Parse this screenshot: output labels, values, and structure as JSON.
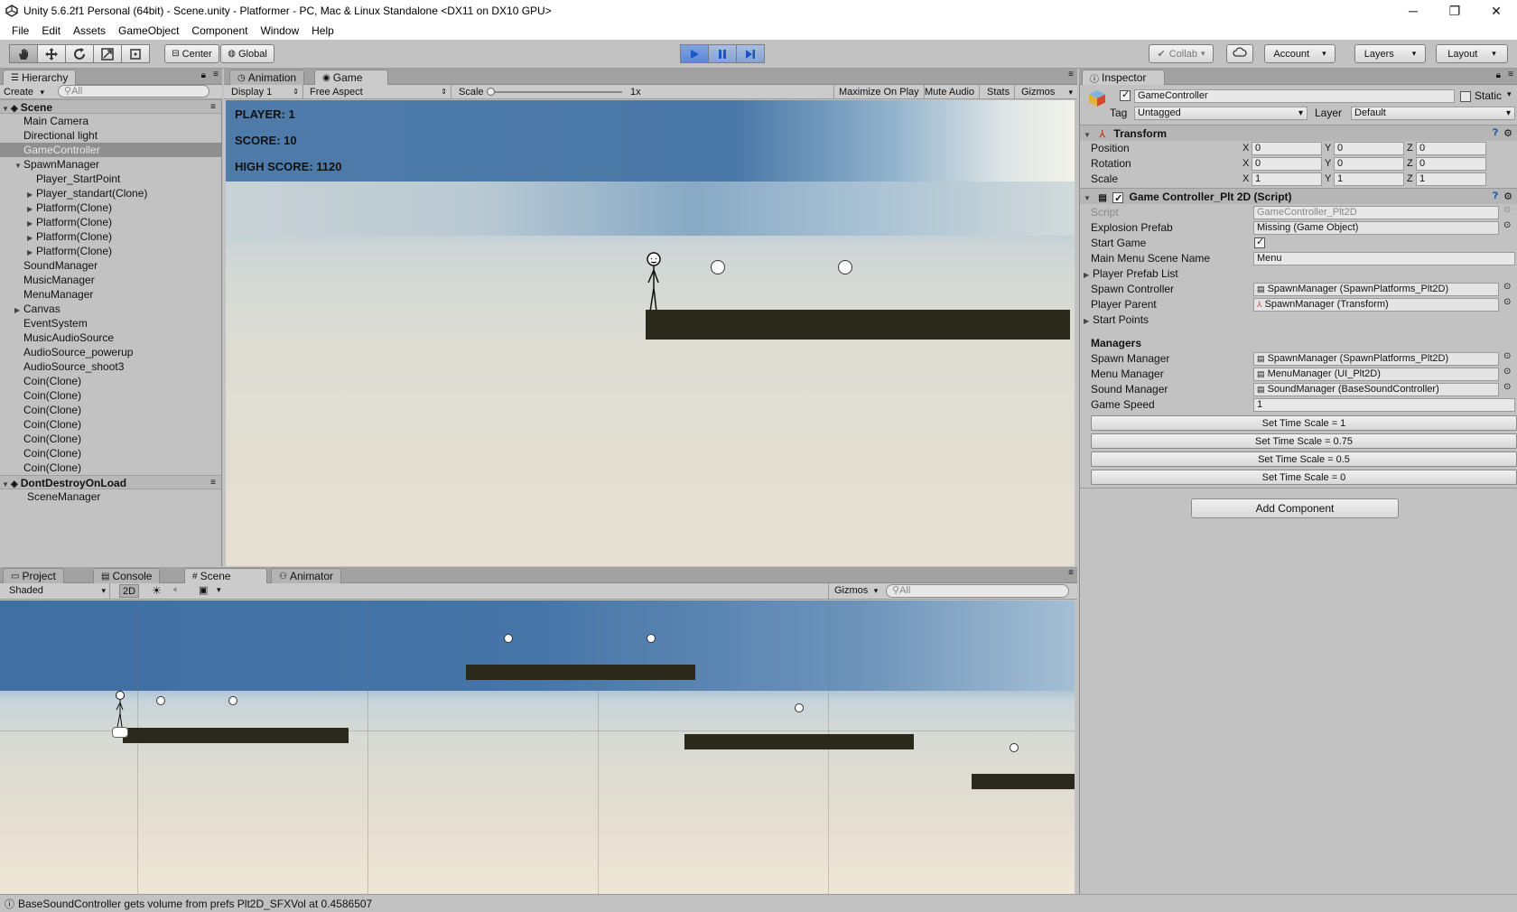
{
  "window": {
    "title": "Unity 5.6.2f1 Personal (64bit) - Scene.unity - Platformer - PC, Mac & Linux Standalone <DX11 on DX10 GPU>"
  },
  "menu": [
    "File",
    "Edit",
    "Assets",
    "GameObject",
    "Component",
    "Window",
    "Help"
  ],
  "toolbar": {
    "pivot": "Center",
    "space": "Global",
    "collab": "Collab",
    "account": "Account",
    "layers": "Layers",
    "layout": "Layout"
  },
  "hierarchy": {
    "tab": "Hierarchy",
    "create": "Create",
    "search_placeholder": "All",
    "scene_name": "Scene",
    "items": [
      {
        "label": "Main Camera",
        "indent": 1,
        "arrow": false
      },
      {
        "label": "Directional light",
        "indent": 1,
        "arrow": false
      },
      {
        "label": "GameController",
        "indent": 1,
        "arrow": false,
        "selected": true
      },
      {
        "label": "SpawnManager",
        "indent": 1,
        "arrow": "open"
      },
      {
        "label": "Player_StartPoint",
        "indent": 2,
        "arrow": false
      },
      {
        "label": "Player_standart(Clone)",
        "indent": 2,
        "arrow": "closed"
      },
      {
        "label": "Platform(Clone)",
        "indent": 2,
        "arrow": "closed"
      },
      {
        "label": "Platform(Clone)",
        "indent": 2,
        "arrow": "closed"
      },
      {
        "label": "Platform(Clone)",
        "indent": 2,
        "arrow": "closed"
      },
      {
        "label": "Platform(Clone)",
        "indent": 2,
        "arrow": "closed"
      },
      {
        "label": "SoundManager",
        "indent": 1,
        "arrow": false
      },
      {
        "label": "MusicManager",
        "indent": 1,
        "arrow": false
      },
      {
        "label": "MenuManager",
        "indent": 1,
        "arrow": false
      },
      {
        "label": "Canvas",
        "indent": 1,
        "arrow": "closed"
      },
      {
        "label": "EventSystem",
        "indent": 1,
        "arrow": false
      },
      {
        "label": "MusicAudioSource",
        "indent": 1,
        "arrow": false
      },
      {
        "label": "AudioSource_powerup",
        "indent": 1,
        "arrow": false
      },
      {
        "label": "AudioSource_shoot3",
        "indent": 1,
        "arrow": false
      },
      {
        "label": "Coin(Clone)",
        "indent": 1,
        "arrow": false
      },
      {
        "label": "Coin(Clone)",
        "indent": 1,
        "arrow": false
      },
      {
        "label": "Coin(Clone)",
        "indent": 1,
        "arrow": false
      },
      {
        "label": "Coin(Clone)",
        "indent": 1,
        "arrow": false
      },
      {
        "label": "Coin(Clone)",
        "indent": 1,
        "arrow": false
      },
      {
        "label": "Coin(Clone)",
        "indent": 1,
        "arrow": false
      },
      {
        "label": "Coin(Clone)",
        "indent": 1,
        "arrow": false
      }
    ],
    "dont_destroy": "DontDestroyOnLoad",
    "dont_destroy_items": [
      {
        "label": "SceneManager"
      }
    ]
  },
  "top_tabs": {
    "animation": "Animation",
    "game": "Game"
  },
  "game_bar": {
    "display": "Display 1",
    "aspect": "Free Aspect",
    "scale_label": "Scale",
    "scale_value": "1x",
    "maximize": "Maximize On Play",
    "mute": "Mute Audio",
    "stats": "Stats",
    "gizmos": "Gizmos"
  },
  "hud": {
    "player": "PLAYER: 1",
    "score": "SCORE: 10",
    "high_score": "HIGH SCORE: 1120"
  },
  "bottom_tabs": {
    "project": "Project",
    "console": "Console",
    "scene": "Scene",
    "animator": "Animator"
  },
  "scene_bar": {
    "shading": "Shaded",
    "mode2d": "2D",
    "gizmos": "Gizmos",
    "search_placeholder": "All"
  },
  "inspector": {
    "tab": "Inspector",
    "object_name": "GameController",
    "static_label": "Static",
    "tag_label": "Tag",
    "tag_value": "Untagged",
    "layer_label": "Layer",
    "layer_value": "Default",
    "transform": {
      "title": "Transform",
      "position_label": "Position",
      "rotation_label": "Rotation",
      "scale_label": "Scale",
      "axis_labels": [
        "X",
        "Y",
        "Z"
      ],
      "position": [
        "0",
        "0",
        "0"
      ],
      "rotation": [
        "0",
        "0",
        "0"
      ],
      "scale": [
        "1",
        "1",
        "1"
      ]
    },
    "script_comp": {
      "title": "Game Controller_Plt 2D (Script)",
      "script_label": "Script",
      "script_value": "GameController_Plt2D",
      "explosion_label": "Explosion Prefab",
      "explosion_value": "Missing (Game Object)",
      "start_game_label": "Start Game",
      "start_game": true,
      "main_menu_label": "Main Menu Scene Name",
      "main_menu_value": "Menu",
      "player_prefab_list": "Player Prefab List",
      "spawn_controller_label": "Spawn Controller",
      "spawn_controller_value": "SpawnManager (SpawnPlatforms_Plt2D)",
      "player_parent_label": "Player Parent",
      "player_parent_value": "SpawnManager (Transform)",
      "start_points": "Start Points",
      "managers_header": "Managers",
      "spawn_manager_label": "Spawn Manager",
      "spawn_manager_value": "SpawnManager (SpawnPlatforms_Plt2D)",
      "menu_manager_label": "Menu Manager",
      "menu_manager_value": "MenuManager (UI_Plt2D)",
      "sound_manager_label": "Sound Manager",
      "sound_manager_value": "SoundManager (BaseSoundController)",
      "game_speed_label": "Game Speed",
      "game_speed_value": "1"
    },
    "buttons": [
      "Set Time Scale = 1",
      "Set Time Scale = 0.75",
      "Set Time Scale = 0.5",
      "Set Time Scale = 0"
    ],
    "add_component": "Add Component"
  },
  "status": {
    "message": "BaseSoundController gets volume from prefs Plt2D_SFXVol at 0.4586507"
  }
}
